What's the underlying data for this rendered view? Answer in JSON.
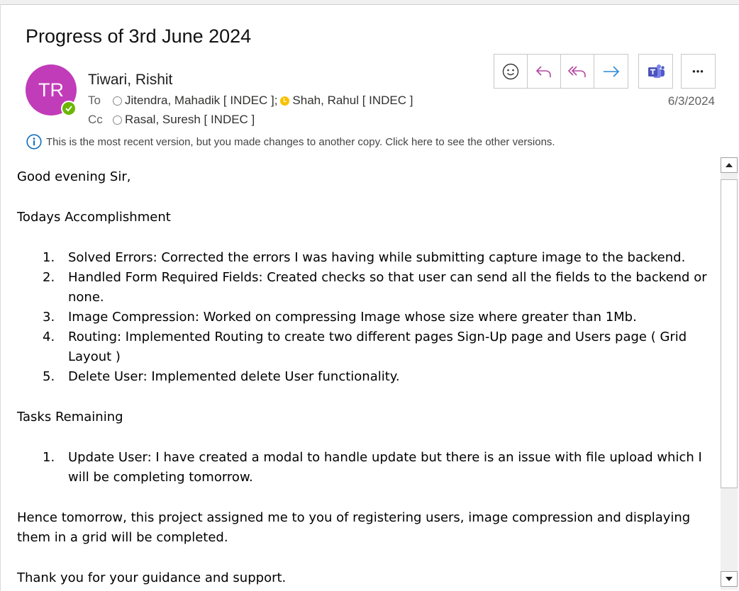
{
  "email": {
    "subject": "Progress of 3rd June 2024",
    "avatar_initials": "TR",
    "sender": "Tiwari, Rishit",
    "to_label": "To",
    "to": [
      "Jitendra, Mahadik [ INDEC ];",
      "Shah, Rahul [ INDEC ]"
    ],
    "cc_label": "Cc",
    "cc": [
      "Rasal, Suresh [ INDEC ]"
    ],
    "date": "6/3/2024",
    "info": "This is the most recent version, but you made changes to another copy. Click here to see the other versions."
  },
  "toolbar": {
    "icons": [
      "emoji-icon",
      "reply-icon",
      "reply-all-icon",
      "forward-icon",
      "teams-icon",
      "more-icon"
    ],
    "more_label": "•••"
  },
  "body": {
    "greeting": "Good evening Sir,",
    "accomplish_heading": "Todays Accomplishment",
    "accomplishments": [
      {
        "num": "1.",
        "text": "Solved Errors: Corrected the errors I was having while submitting capture image to the backend."
      },
      {
        "num": "2.",
        "text": "Handled Form Required Fields: Created checks so that user can send all the fields to the backend or none."
      },
      {
        "num": "3.",
        "text": "Image Compression: Worked on compressing Image whose size where greater than 1Mb."
      },
      {
        "num": "4.",
        "text": "Routing: Implemented Routing to create two different pages Sign-Up page and Users page ( Grid Layout )"
      },
      {
        "num": "5.",
        "text": "Delete User: Implemented delete User functionality."
      }
    ],
    "remaining_heading": "Tasks Remaining",
    "remaining": [
      {
        "num": "1.",
        "text": "Update User: I have created a modal to handle update but there is an issue with file upload which I will be completing tomorrow."
      }
    ],
    "closing": "Hence tomorrow, this project assigned me to you of registering users, image compression and displaying them in a grid will be completed.",
    "thanks": "Thank you for your guidance and support."
  },
  "colors": {
    "avatar": "#c13cb9",
    "presence_available": "#6bb700",
    "presence_away": "#f8c200",
    "reply_icons": "#b4479f",
    "forward_icon": "#2b88d8",
    "teams": "#5059c9",
    "info_icon": "#0f6cbd"
  }
}
